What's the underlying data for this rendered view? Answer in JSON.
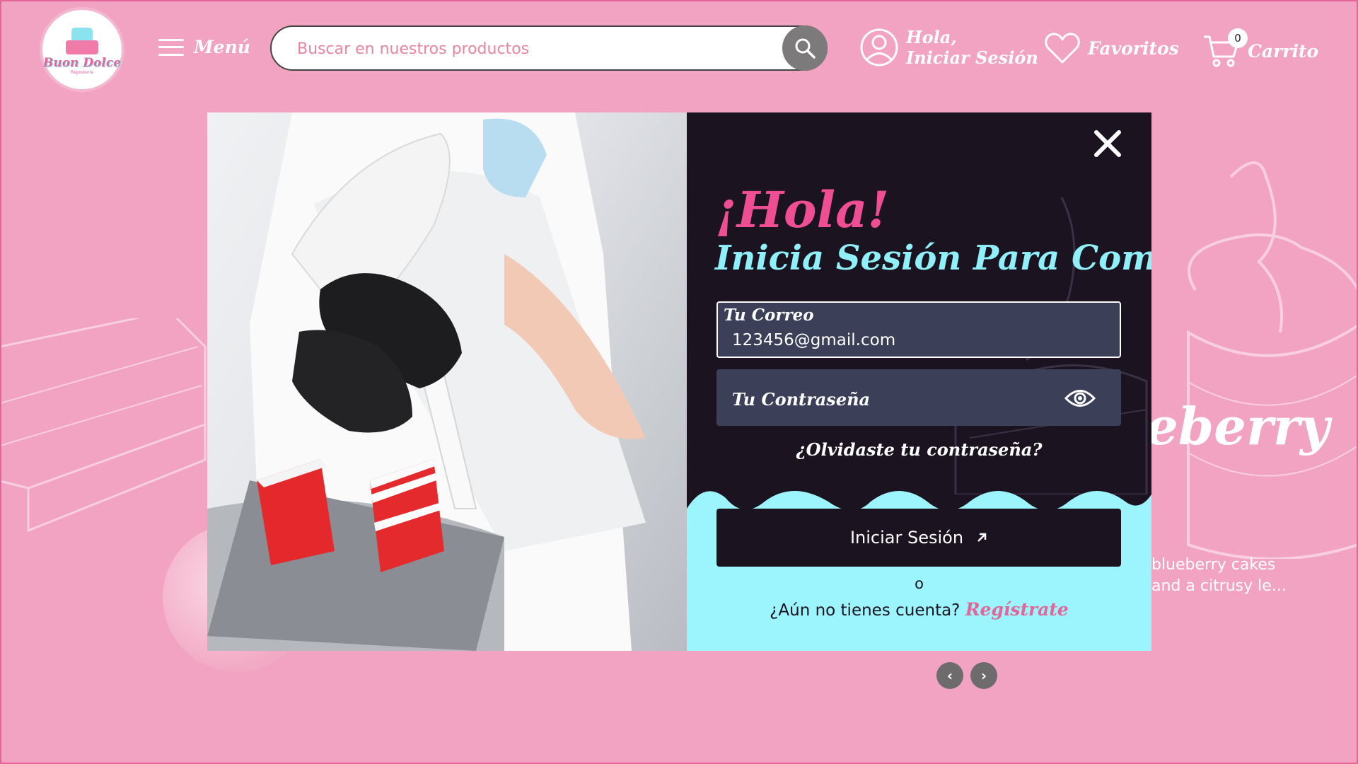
{
  "header": {
    "logo_name": "Buon Dolce",
    "logo_sub": "Repostería",
    "menu_label": "Menú",
    "search_placeholder": "Buscar en nuestros productos",
    "login_line1": "Hola,",
    "login_line2": "Iniciar Sesión",
    "favorites_label": "Favoritos",
    "cart_label": "Carrito",
    "cart_count": "0"
  },
  "background": {
    "slide_title": "eberry",
    "slide_desc_line1": "blueberry cakes",
    "slide_desc_line2": "and a citrusy le..."
  },
  "modal": {
    "greeting": "¡Hola!",
    "subtitle": "Inicia Sesión Para Comprar",
    "email_label": "Tu Correo",
    "email_value": "123456@gmail.com",
    "password_label": "Tu Contraseña",
    "forgot_label": "¿Olvidaste tu contraseña?",
    "submit_label": "Iniciar Sesión",
    "or_label": "o",
    "no_account": "¿Aún no tienes cuenta?",
    "register_label": "Regístrate"
  },
  "colors": {
    "page_bg": "#f1a3c1",
    "panel_bg": "#1b1420",
    "accent_pink": "#ef4e95",
    "accent_cyan": "#8ff0fa",
    "field_bg": "#3b3f58"
  }
}
